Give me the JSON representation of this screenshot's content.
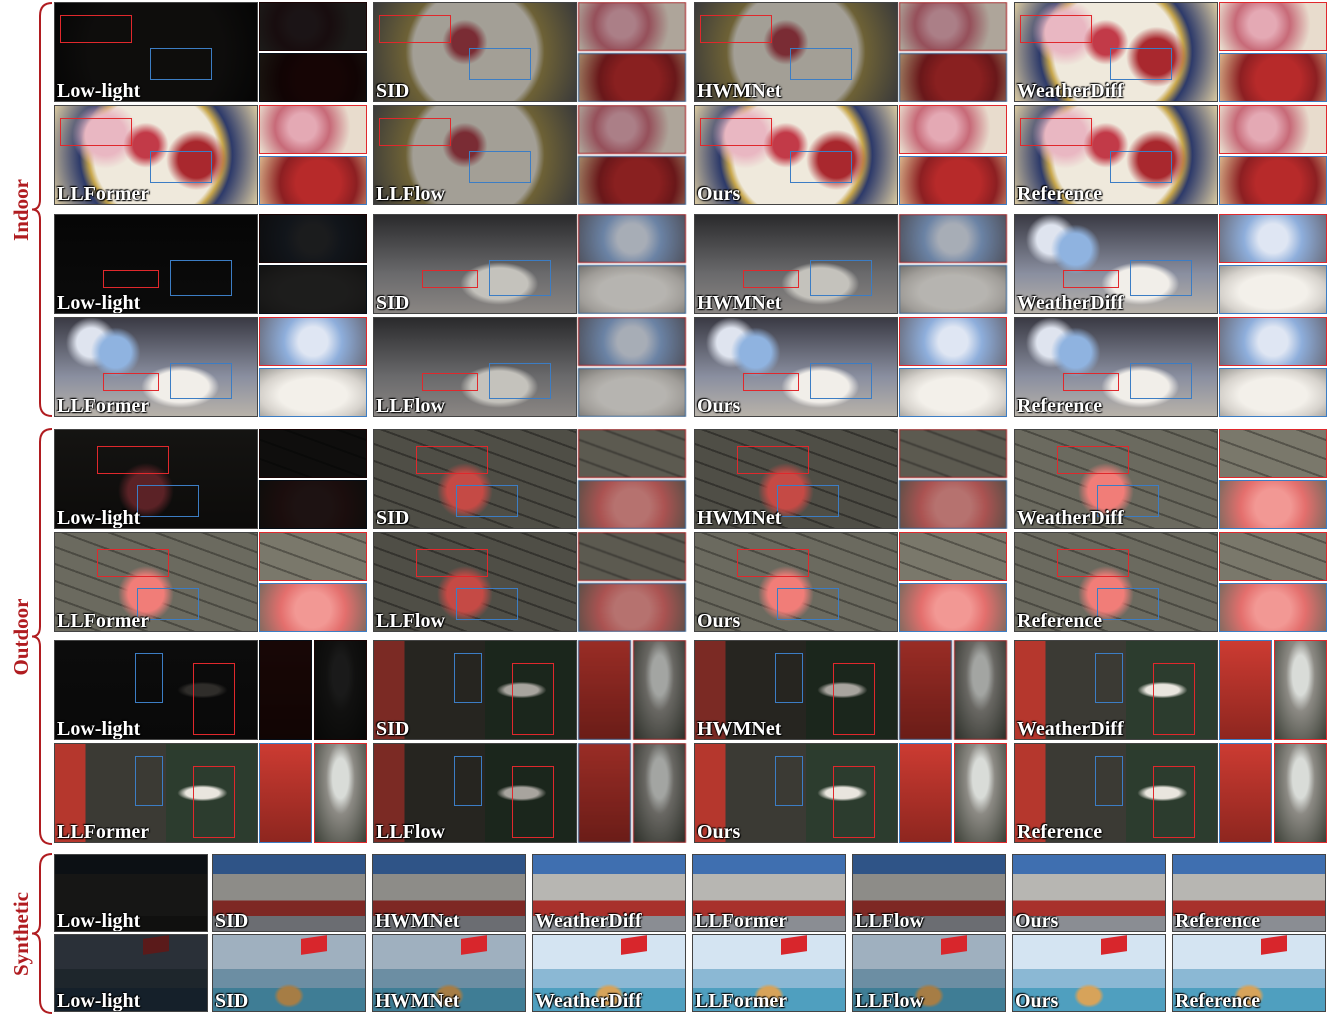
{
  "figure": {
    "sections": [
      {
        "id": "indoor",
        "label": "Indoor",
        "scenes": 2
      },
      {
        "id": "outdoor",
        "label": "Outdoor",
        "scenes": 2
      },
      {
        "id": "synthetic",
        "label": "Synthetic",
        "scenes": 2
      }
    ],
    "methods_grid": [
      [
        "Low-light",
        "SID",
        "HWMNet",
        "WeatherDiff"
      ],
      [
        "LLFormer",
        "LLFlow",
        "Ours",
        "Reference"
      ]
    ],
    "methods_synthetic": [
      "Low-light",
      "SID",
      "HWMNet",
      "WeatherDiff",
      "LLFormer",
      "LLFlow",
      "Ours",
      "Reference"
    ],
    "colors": {
      "label_accent": "#b01c20",
      "roi_red": "#e0282c",
      "roi_blue": "#3c7dc4",
      "brace": "#b01c20"
    },
    "scenes": [
      {
        "id": "peony-plate",
        "section": "indoor",
        "content": "porcelain plate with peony flowers"
      },
      {
        "id": "teddy-flowers",
        "section": "indoor",
        "content": "plush toy with blue flowers"
      },
      {
        "id": "rose-wall",
        "section": "outdoor",
        "content": "red rose in front of stone wall"
      },
      {
        "id": "cartoon-booth",
        "section": "outdoor",
        "content": "cartoon figurine near red phone booth"
      },
      {
        "id": "temple-gate",
        "section": "synthetic",
        "content": "temple gate with blue sky"
      },
      {
        "id": "flag-woman",
        "section": "synthetic",
        "content": "woman raising arms by a lake with flag"
      }
    ]
  }
}
